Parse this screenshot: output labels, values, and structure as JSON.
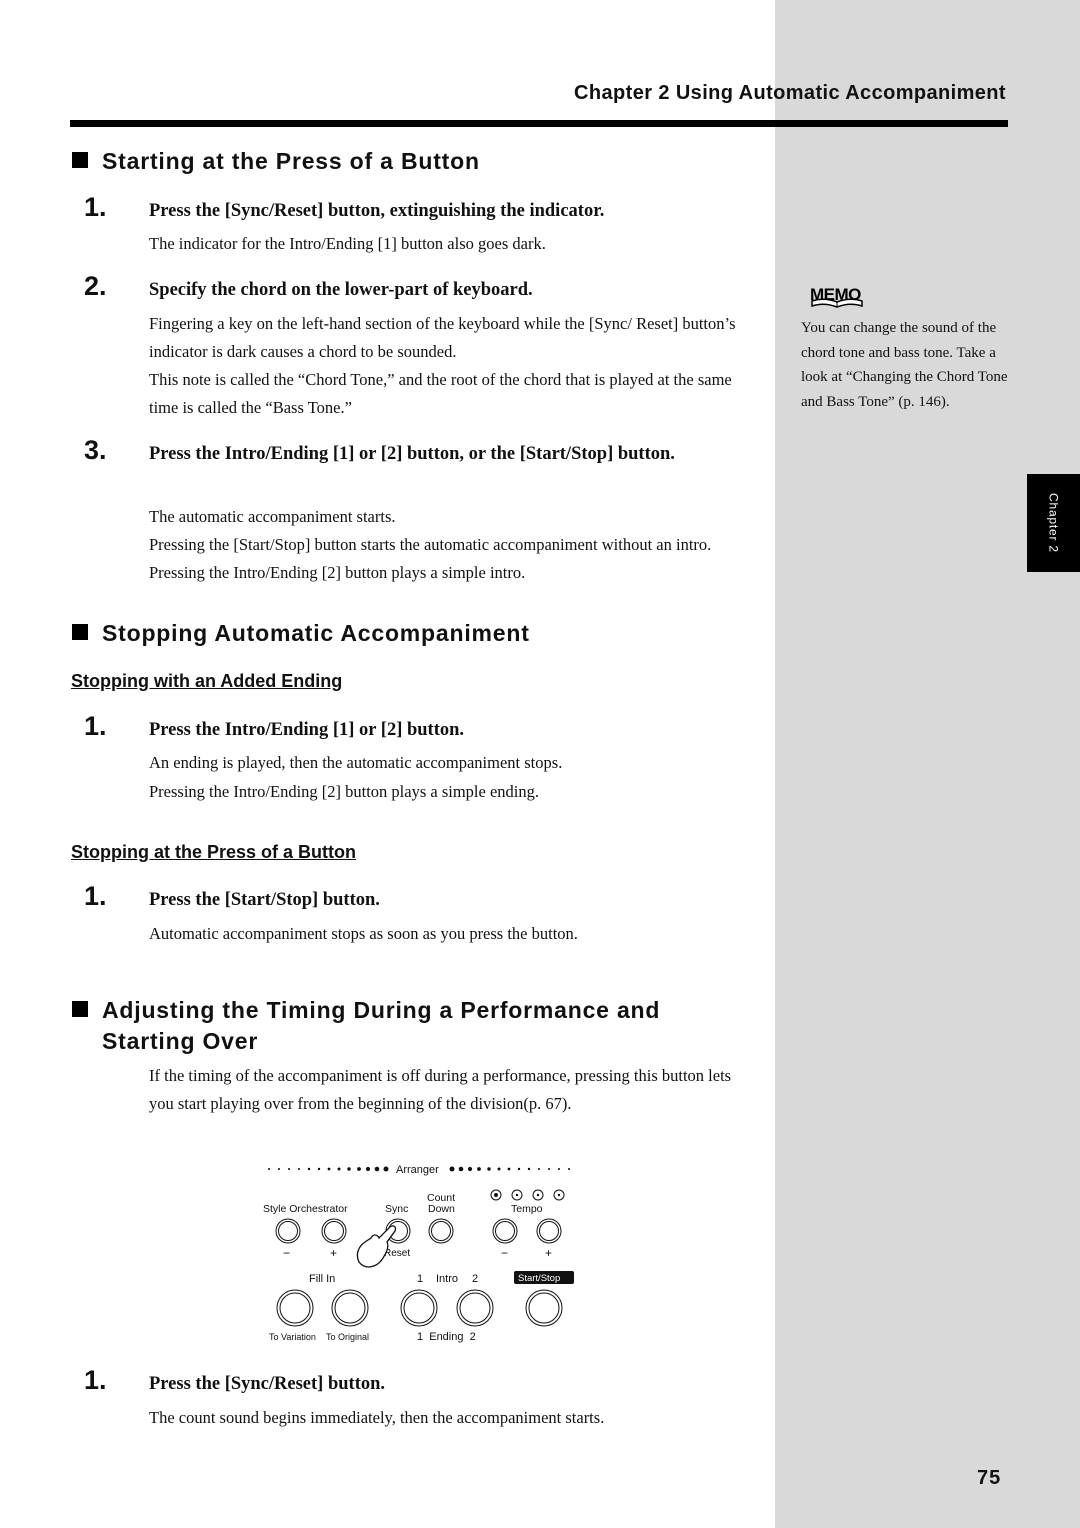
{
  "header": {
    "chapter_title": "Chapter 2 Using Automatic Accompaniment"
  },
  "sections": [
    {
      "title": "Starting at the Press of a Button",
      "steps": [
        {
          "number": "1.",
          "title": "Press the [Sync/Reset] button, extinguishing the indicator.",
          "body": [
            "The indicator for the Intro/Ending [1] button also goes dark."
          ]
        },
        {
          "number": "2.",
          "title": "Specify the chord on the lower-part of keyboard.",
          "body": [
            "Fingering a key on the left-hand section of the keyboard while the [Sync/ Reset] button’s indicator is dark causes a chord to be sounded.",
            "This note is called the “Chord Tone,” and the root of the chord that is played at the same time is called the “Bass Tone.”"
          ]
        },
        {
          "number": "3.",
          "title": "Press the Intro/Ending [1] or [2] button, or the [Start/Stop] button.",
          "body": [
            "The automatic accompaniment starts.",
            "Pressing the [Start/Stop] button starts the automatic accompaniment without an intro. Pressing the Intro/Ending [2] button plays a simple intro."
          ]
        }
      ]
    },
    {
      "title": "Stopping Automatic Accompaniment",
      "subsections": [
        {
          "title": "Stopping with an Added Ending",
          "steps": [
            {
              "number": "1.",
              "title": "Press the Intro/Ending [1] or [2] button.",
              "body": [
                "An ending is played, then the automatic accompaniment stops.",
                "Pressing the Intro/Ending [2] button plays a simple ending."
              ]
            }
          ]
        },
        {
          "title": "Stopping at the Press of a Button",
          "steps": [
            {
              "number": "1.",
              "title": "Press the [Start/Stop] button.",
              "body": [
                "Automatic accompaniment stops as soon as you press the button."
              ]
            }
          ]
        }
      ]
    },
    {
      "title_line1": "Adjusting the Timing During a Performance and",
      "title_line2": "Starting Over",
      "intro": "If the timing of the accompaniment is off during a performance, pressing this button lets you start playing over from the beginning of the division(p. 67).",
      "steps": [
        {
          "number": "1.",
          "title": "Press the [Sync/Reset] button.",
          "body": [
            "The count sound begins immediately, then the accompaniment starts."
          ]
        }
      ]
    }
  ],
  "panel_diagram": {
    "group_label": "Arranger",
    "labels": {
      "style_orchestrator": "Style Orchestrator",
      "sync": "Sync",
      "count": "Count",
      "down": "Down",
      "tempo": "Tempo",
      "minus": "−",
      "plus": "+",
      "reset": "Reset",
      "fill_in": "Fill In",
      "intro_1": "1",
      "intro": "Intro",
      "intro_2": "2",
      "start_stop": "Start/Stop",
      "to_variation": "To Variation",
      "to_original": "To Original",
      "ending": "1  Ending  2"
    },
    "tempo_indicators_lit": [
      true,
      false,
      false,
      false
    ]
  },
  "memo": {
    "icon_label": "MEMO",
    "text": "You can change the sound of the chord tone and bass tone. Take a look at “Changing the Chord Tone and Bass Tone” (p. 146)."
  },
  "chapter_tab": "Chapter 2",
  "page_number": "75"
}
